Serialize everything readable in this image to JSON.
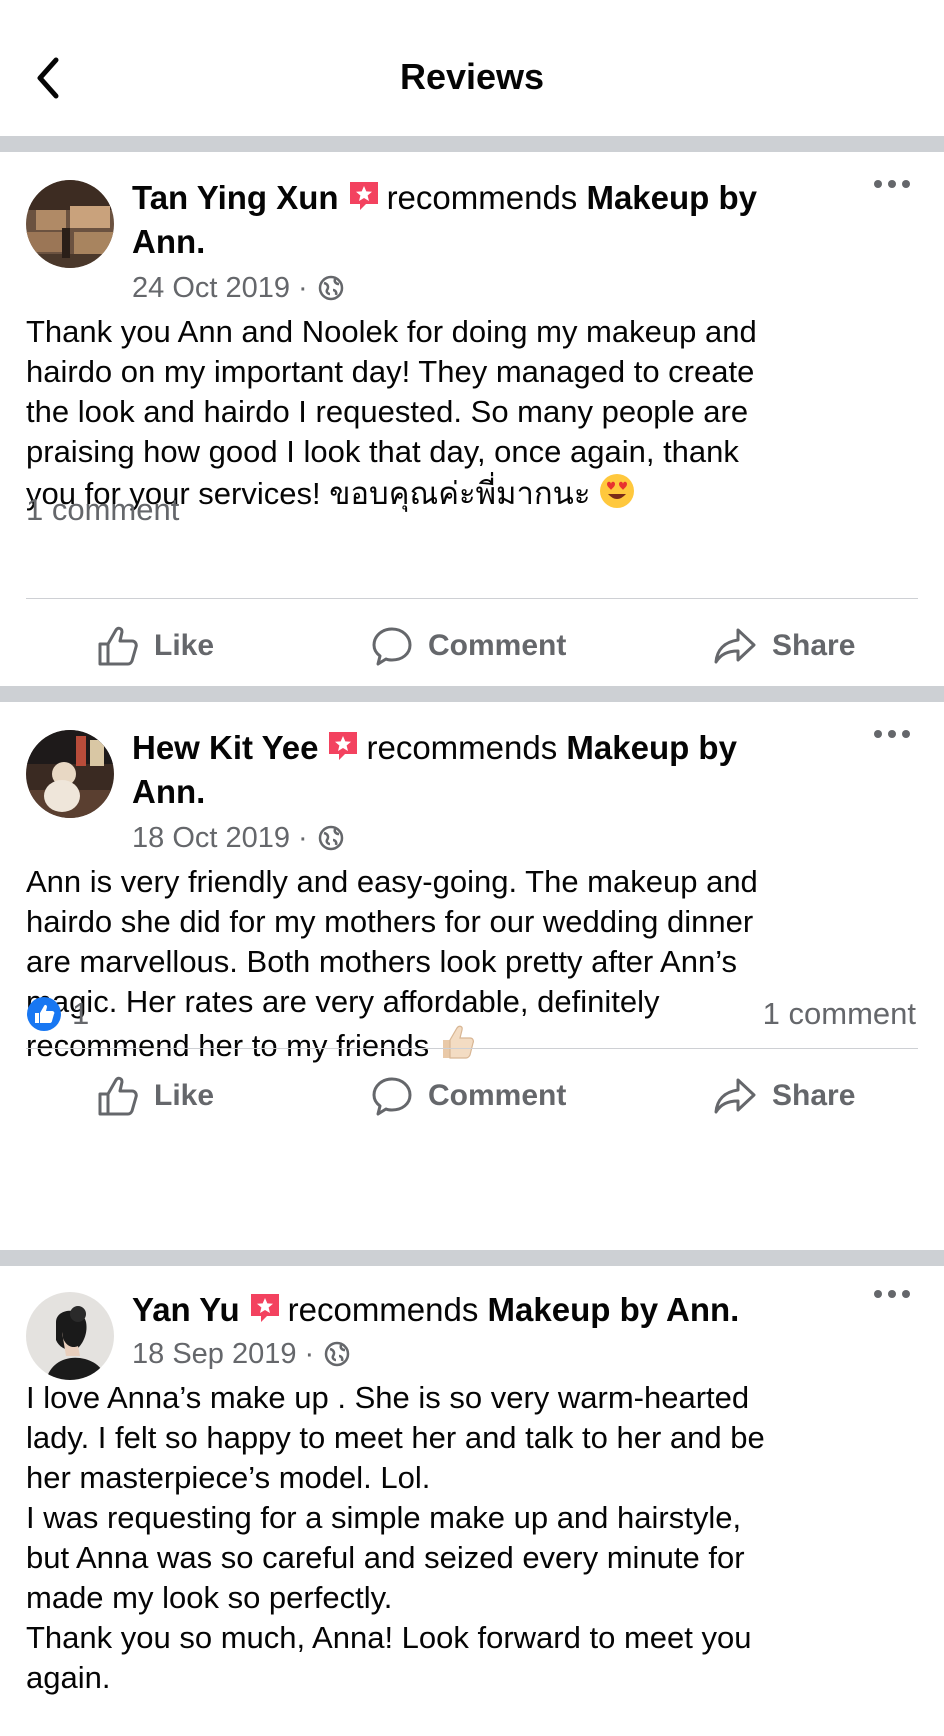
{
  "header": {
    "title": "Reviews"
  },
  "reviews": [
    {
      "author": "Tan Ying Xun",
      "recommends": "recommends",
      "page": "Makeup by Ann.",
      "page_line1": "Makeup by",
      "page_line2": "Ann.",
      "date": "24 Oct 2019",
      "text": "Thank you Ann and Noolek for doing my makeup and\nhairdo on my important day! They managed to create\nthe look and hairdo I requested. So many people are\npraising how good I look that day, once again, thank\nyou for your services! ขอบคุณค่ะพี่มากนะ",
      "emoji": "heart-eyes-emoji",
      "comments": "1 comment"
    },
    {
      "author": "Hew Kit Yee",
      "recommends": "recommends",
      "page_line1": "Makeup by",
      "page_line2": "Ann.",
      "date": "18 Oct 2019",
      "text": "Ann is very friendly and easy-going. The makeup and\nhairdo she did for my mothers for our wedding dinner\nare marvellous. Both mothers look pretty after Ann’s\nmagic. Her rates are very affordable, definitely\nrecommend her to my friends",
      "emoji": "thumbs-up-emoji",
      "likes": "1",
      "comments": "1 comment"
    },
    {
      "author": "Yan Yu",
      "recommends": "recommends",
      "page": "Makeup by Ann.",
      "date": "18 Sep 2019",
      "text": "I love Anna’s make up . She is so very warm-hearted\nlady. I felt so happy to meet her and talk to her and be\nher masterpiece’s model. Lol.\nI was requesting for a simple make up and hairstyle,\nbut Anna was so careful and seized every minute for\nmade my look so perfectly.\nThank you so much, Anna! Look forward to meet you\nagain."
    }
  ],
  "actions": {
    "like": "Like",
    "comment": "Comment",
    "share": "Share"
  },
  "colors": {
    "separator": "#cdd0d4",
    "secondary_text": "#65676b",
    "recommend_badge": "#f3425f",
    "like_blue": "#1877f2"
  },
  "icons": {
    "back": "chevron-left-icon",
    "more": "more-dots-icon",
    "privacy": "globe-icon",
    "recommend": "recommend-badge-icon",
    "like": "thumbs-up-icon",
    "comment": "comment-bubble-icon",
    "share": "share-arrow-icon"
  }
}
